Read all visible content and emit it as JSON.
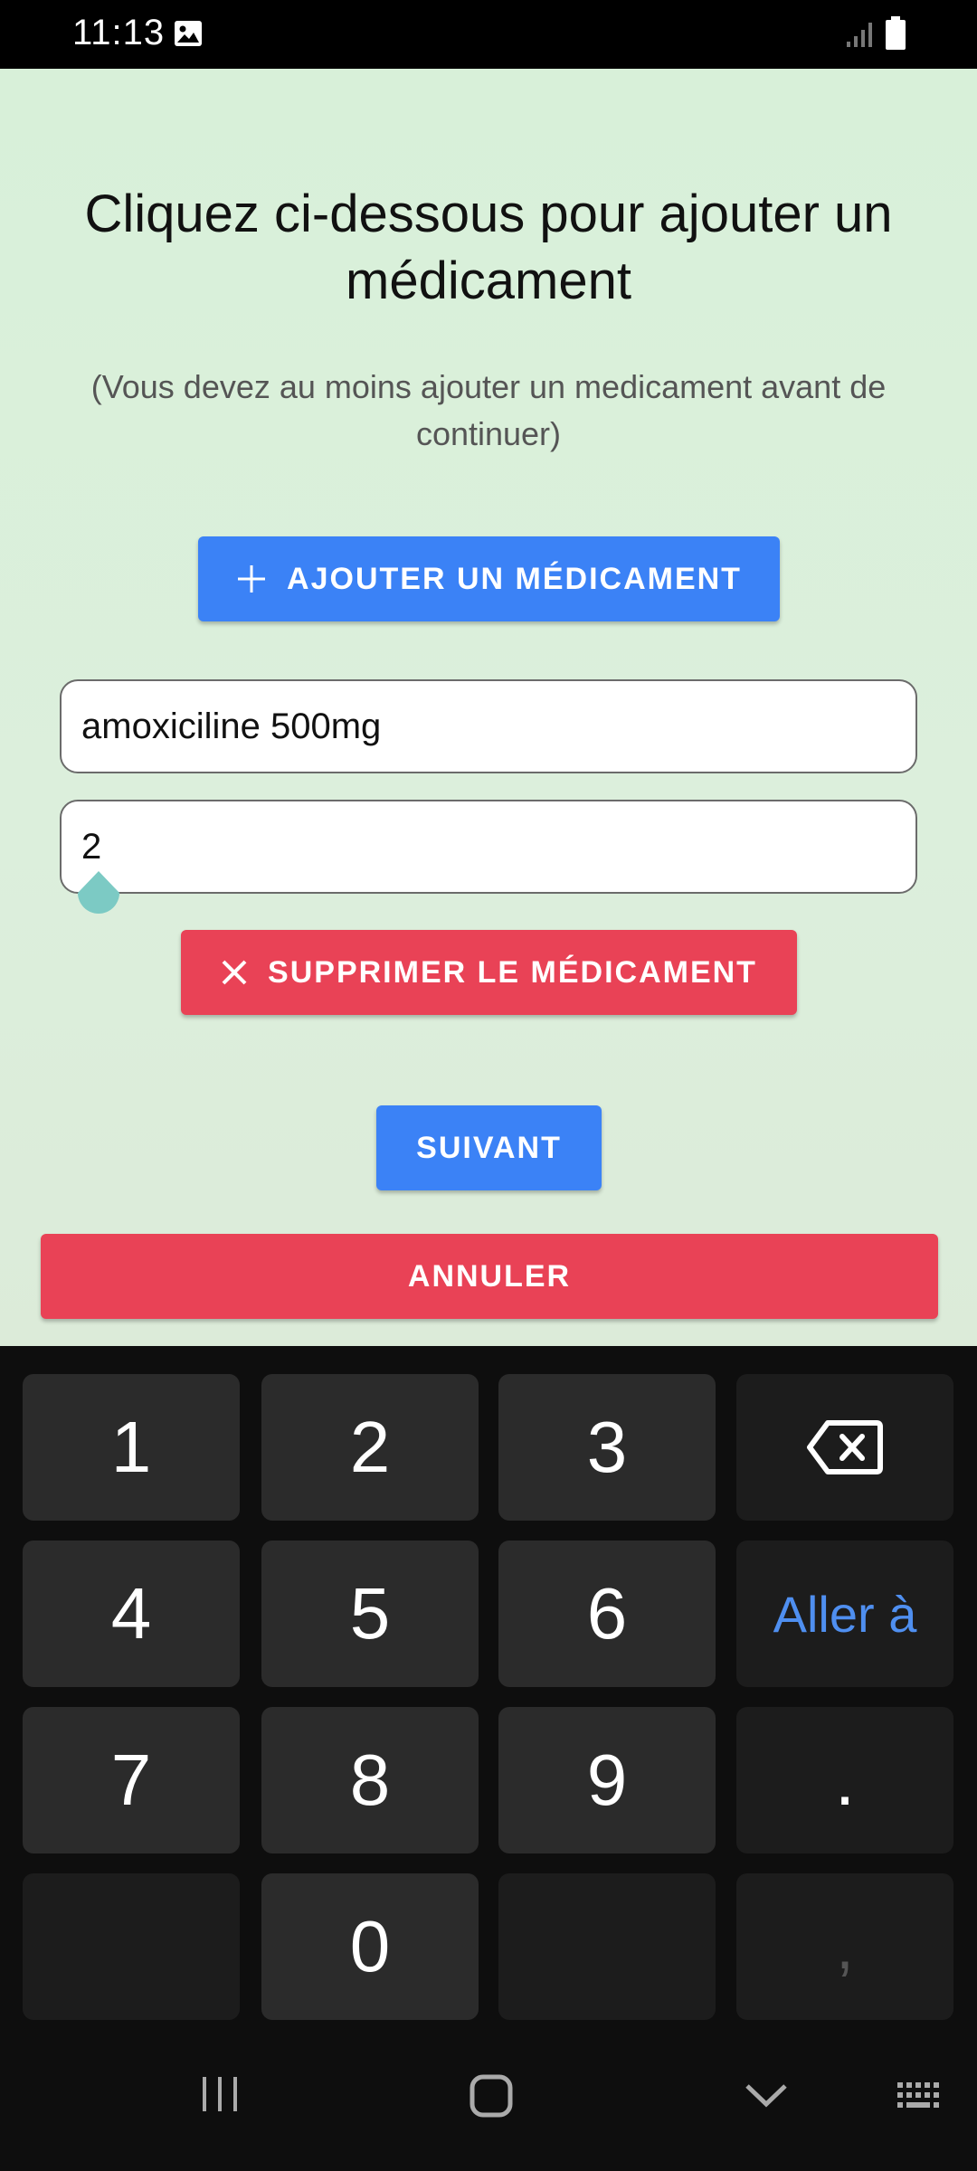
{
  "status_bar": {
    "time": "11:13",
    "icons": [
      "gallery-icon",
      "signal-icon",
      "battery-icon"
    ]
  },
  "screen": {
    "title": "Cliquez ci-dessous pour ajouter un médicament",
    "subtitle": "(Vous devez au moins ajouter un medicament avant de continuer)",
    "add_button": {
      "icon": "plus-icon",
      "label": "AJOUTER UN MÉDICAMENT"
    },
    "medication": {
      "name_value": "amoxiciline 500mg",
      "quantity_value": "2"
    },
    "delete_button": {
      "icon": "close-icon",
      "label": "SUPPRIMER LE MÉDICAMENT"
    },
    "next_button": {
      "label": "SUIVANT"
    },
    "cancel_button": {
      "label": "ANNULER"
    }
  },
  "colors": {
    "primary": "#3b82f6",
    "danger": "#e94256",
    "background": "#d8f0d9",
    "keyboard_accent": "#4f8ff0"
  },
  "keyboard": {
    "keys": [
      "1",
      "2",
      "3",
      "4",
      "5",
      "6",
      "7",
      "8",
      "9",
      "0"
    ],
    "go_label": "Aller à",
    "dot_label": ".",
    "comma_label": ","
  }
}
